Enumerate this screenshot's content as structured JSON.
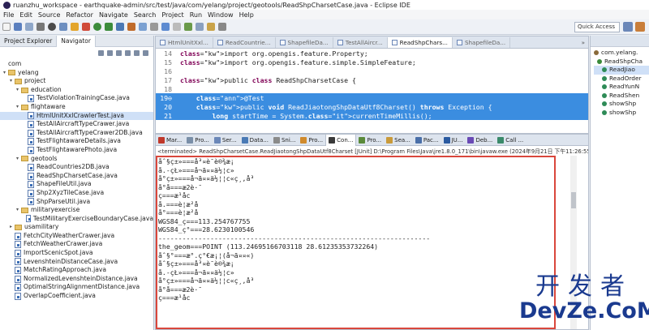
{
  "window": {
    "title": "ruanzhu_workspace - earthquake-admin/src/test/java/com/yelang/project/geotools/ReadShpCharsetCase.java - Eclipse IDE"
  },
  "menu": [
    "File",
    "Edit",
    "Source",
    "Refactor",
    "Navigate",
    "Search",
    "Project",
    "Run",
    "Window",
    "Help"
  ],
  "toolbar": {
    "quick_access": "Quick Access"
  },
  "left_panel": {
    "tabs": [
      "Project Explorer",
      "Navigator"
    ],
    "tree": [
      {
        "label": "com",
        "type": "text",
        "indent": 0
      },
      {
        "label": "yelang",
        "type": "folder",
        "indent": 0,
        "arrow": "▾"
      },
      {
        "label": "project",
        "type": "folder",
        "indent": 1,
        "arrow": "▾"
      },
      {
        "label": "education",
        "type": "folder",
        "indent": 2,
        "arrow": "▾"
      },
      {
        "label": "TestViolationTrainingCase.java",
        "type": "file",
        "indent": 3
      },
      {
        "label": "flightaware",
        "type": "folder",
        "indent": 2,
        "arrow": "▾"
      },
      {
        "label": "HtmlUnitXxlCrawlerTest.java",
        "type": "file",
        "indent": 3,
        "selected": true
      },
      {
        "label": "TestAllAircraftTypeCrawer.java",
        "type": "file",
        "indent": 3
      },
      {
        "label": "TestAllAircraftTypeCrawer2DB.java",
        "type": "file",
        "indent": 3
      },
      {
        "label": "TestFlightawareDetails.java",
        "type": "file",
        "indent": 3
      },
      {
        "label": "TestFlightawarePhoto.java",
        "type": "file",
        "indent": 3
      },
      {
        "label": "geotools",
        "type": "folder",
        "indent": 2,
        "arrow": "▾"
      },
      {
        "label": "ReadCountries2DB.java",
        "type": "file",
        "indent": 3
      },
      {
        "label": "ReadShpCharsetCase.java",
        "type": "file",
        "indent": 3
      },
      {
        "label": "ShapeFileUtil.java",
        "type": "file",
        "indent": 3
      },
      {
        "label": "Shp2XyzTileCase.java",
        "type": "file",
        "indent": 3
      },
      {
        "label": "ShpParseUtil.java",
        "type": "file",
        "indent": 3
      },
      {
        "label": "militaryexercise",
        "type": "folder",
        "indent": 2,
        "arrow": "▾"
      },
      {
        "label": "TestMilitaryExerciseBoundaryCase.java",
        "type": "file",
        "indent": 3
      },
      {
        "label": "usamilitary",
        "type": "folder",
        "indent": 1,
        "arrow": "▸"
      },
      {
        "label": "FetchCityWeatherCrawer.java",
        "type": "file",
        "indent": 1
      },
      {
        "label": "FetchWeatherCrawer.java",
        "type": "file",
        "indent": 1
      },
      {
        "label": "ImportScenicSpot.java",
        "type": "file",
        "indent": 1
      },
      {
        "label": "LevenshteinDistanceCase.java",
        "type": "file",
        "indent": 1
      },
      {
        "label": "MatchRatingApproach.java",
        "type": "file",
        "indent": 1
      },
      {
        "label": "NormalizedLevenshteinDistance.java",
        "type": "file",
        "indent": 1
      },
      {
        "label": "OptimalStringAlignmentDistance.java",
        "type": "file",
        "indent": 1
      },
      {
        "label": "OverlapCoefficient.java",
        "type": "file",
        "indent": 1
      }
    ]
  },
  "editor": {
    "tabs": [
      {
        "label": "HtmlUnitXxl...",
        "active": false
      },
      {
        "label": "ReadCountrie...",
        "active": false
      },
      {
        "label": "ShapefileDa...",
        "active": false
      },
      {
        "label": "TestAllAircr...",
        "active": false
      },
      {
        "label": "ReadShpChars...",
        "active": true
      },
      {
        "label": "ShapefileDa...",
        "active": false
      }
    ],
    "lines": [
      {
        "num": "14",
        "text": "import org.opengis.feature.Property;"
      },
      {
        "num": "15",
        "text": "import org.opengis.feature.simple.SimpleFeature;"
      },
      {
        "num": "16",
        "text": ""
      },
      {
        "num": "17",
        "text": "public class ReadShpCharsetCase {"
      },
      {
        "num": "18",
        "text": ""
      },
      {
        "num": "19⊖",
        "text": "    @Test",
        "hl": true
      },
      {
        "num": "20",
        "text": "    public void ReadJiaotongShpDataUtf8Charset() throws Exception {",
        "hl": true
      },
      {
        "num": "21",
        "text": "        long startTime = System.currentTimeMillis();",
        "hl": true
      }
    ]
  },
  "bottom": {
    "tabs": [
      "Mar...",
      "Pro...",
      "Ser...",
      "Data...",
      "Sni...",
      "Pro...",
      "Con...",
      "Pro...",
      "Sea...",
      "Pac...",
      "JU...",
      "Deb...",
      "Call ..."
    ],
    "active_tab": "Con...",
    "status": "<terminated> ReadShpCharsetCase.ReadJiaotongShpDataUtf8Charset [JUnit] D:\\Program Files\\Java\\jre1.8.0_171\\bin\\javaw.exe (2024年9月21日 下午11:26:55",
    "console_lines": [
      "åˆ§ç±»===å³¤è¯è®¾æ¡",
      "å.-çŁ»===å¬ã¤¤ä½¦c»",
      "å°ç±»===å¬ã¤¤ä½¦¦c«ç¸‚å³",
      "å°å===æ2è·¯",
      "ç===æ¹åc",
      "å.===è¦æ²å",
      "å°===è¦æ²å",
      "WGS84_ç===113.254767755",
      "WGS84_ç°===28.6230100546",
      "--------------------------------------------------------------------",
      "the_geom===POINT (113.24695166703118 28.61235353732264)",
      "åˆ§°===æ°.ç°€æ¡¦(å¬ã¤¤«)",
      "åˆ§ç±»===å³¤è¯è®¾æ¡",
      "å.-çŁ»===å¬ã¤¤ä½¦c»",
      "å°ç±»===å¬ã¤¤ä½¦¦c«ç¸‚å³",
      "å°å===æ2è·¯",
      "ç===æ¹åc"
    ]
  },
  "right_panel": {
    "items": [
      {
        "label": "com.yelang.",
        "kind": "package"
      },
      {
        "label": "ReadShpCha",
        "kind": "class"
      },
      {
        "label": "ReadJiao",
        "kind": "method",
        "selected": true
      },
      {
        "label": "ReadOrder",
        "kind": "method"
      },
      {
        "label": "ReadYunN",
        "kind": "method"
      },
      {
        "label": "ReadShen",
        "kind": "method"
      },
      {
        "label": "showShp",
        "kind": "method"
      },
      {
        "label": "showShp",
        "kind": "method"
      }
    ]
  },
  "watermark": {
    "cn": "开发者",
    "en": "DevZe.CoM"
  },
  "colors": {
    "accent": "#3b8de0",
    "keyword": "#7f0055",
    "highlight_box": "#d9473c",
    "watermark": "#1a3a8f"
  }
}
